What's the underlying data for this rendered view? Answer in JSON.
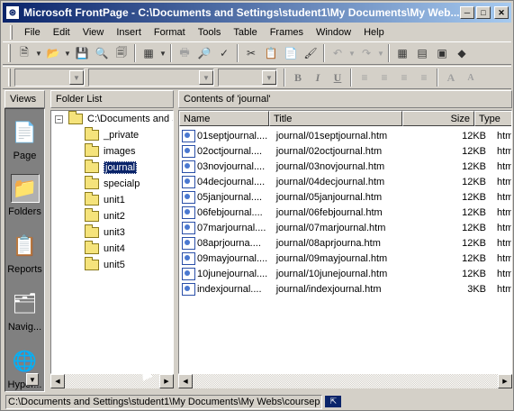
{
  "window": {
    "title": "Microsoft FrontPage - C:\\Documents and Settings\\student1\\My Documents\\My Web..."
  },
  "menu": [
    "File",
    "Edit",
    "View",
    "Insert",
    "Format",
    "Tools",
    "Table",
    "Frames",
    "Window",
    "Help"
  ],
  "views": {
    "header": "Views",
    "items": [
      {
        "label": "Page",
        "icon": "page-view-icon"
      },
      {
        "label": "Folders",
        "icon": "folders-view-icon"
      },
      {
        "label": "Reports",
        "icon": "reports-view-icon"
      },
      {
        "label": "Navig...",
        "icon": "navigation-view-icon"
      },
      {
        "label": "Hyper...",
        "icon": "hyperlinks-view-icon"
      }
    ]
  },
  "folder_list": {
    "header": "Folder List",
    "root": "C:\\Documents and S",
    "folders": [
      "_private",
      "images",
      "journal",
      "specialp",
      "unit1",
      "unit2",
      "unit3",
      "unit4",
      "unit5"
    ],
    "selected": "journal"
  },
  "contents": {
    "header": "Contents of 'journal'",
    "columns": [
      "Name",
      "Title",
      "Size",
      "Type"
    ],
    "files": [
      {
        "name": "01septjournal....",
        "title": "journal/01septjournal.htm",
        "size": "12KB",
        "type": "htm"
      },
      {
        "name": "02octjournal....",
        "title": "journal/02octjournal.htm",
        "size": "12KB",
        "type": "htm"
      },
      {
        "name": "03novjournal....",
        "title": "journal/03novjournal.htm",
        "size": "12KB",
        "type": "htm"
      },
      {
        "name": "04decjournal....",
        "title": "journal/04decjournal.htm",
        "size": "12KB",
        "type": "htm"
      },
      {
        "name": "05janjournal....",
        "title": "journal/05janjournal.htm",
        "size": "12KB",
        "type": "htm"
      },
      {
        "name": "06febjournal....",
        "title": "journal/06febjournal.htm",
        "size": "12KB",
        "type": "htm"
      },
      {
        "name": "07marjournal....",
        "title": "journal/07marjournal.htm",
        "size": "12KB",
        "type": "htm"
      },
      {
        "name": "08aprjourna....",
        "title": "journal/08aprjourna.htm",
        "size": "12KB",
        "type": "htm"
      },
      {
        "name": "09mayjournal....",
        "title": "journal/09mayjournal.htm",
        "size": "12KB",
        "type": "htm"
      },
      {
        "name": "10junejournal....",
        "title": "journal/10junejournal.htm",
        "size": "12KB",
        "type": "htm"
      },
      {
        "name": "indexjournal....",
        "title": "journal/indexjournal.htm",
        "size": "3KB",
        "type": "htm"
      }
    ]
  },
  "status": {
    "path": "C:\\Documents and Settings\\student1\\My Documents\\My Webs\\coursep"
  },
  "format_buttons": [
    "B",
    "I",
    "U"
  ],
  "colors": {
    "title_start": "#0a246a",
    "title_end": "#a6caf0",
    "face": "#d4d0c8",
    "selection": "#0a246a"
  }
}
